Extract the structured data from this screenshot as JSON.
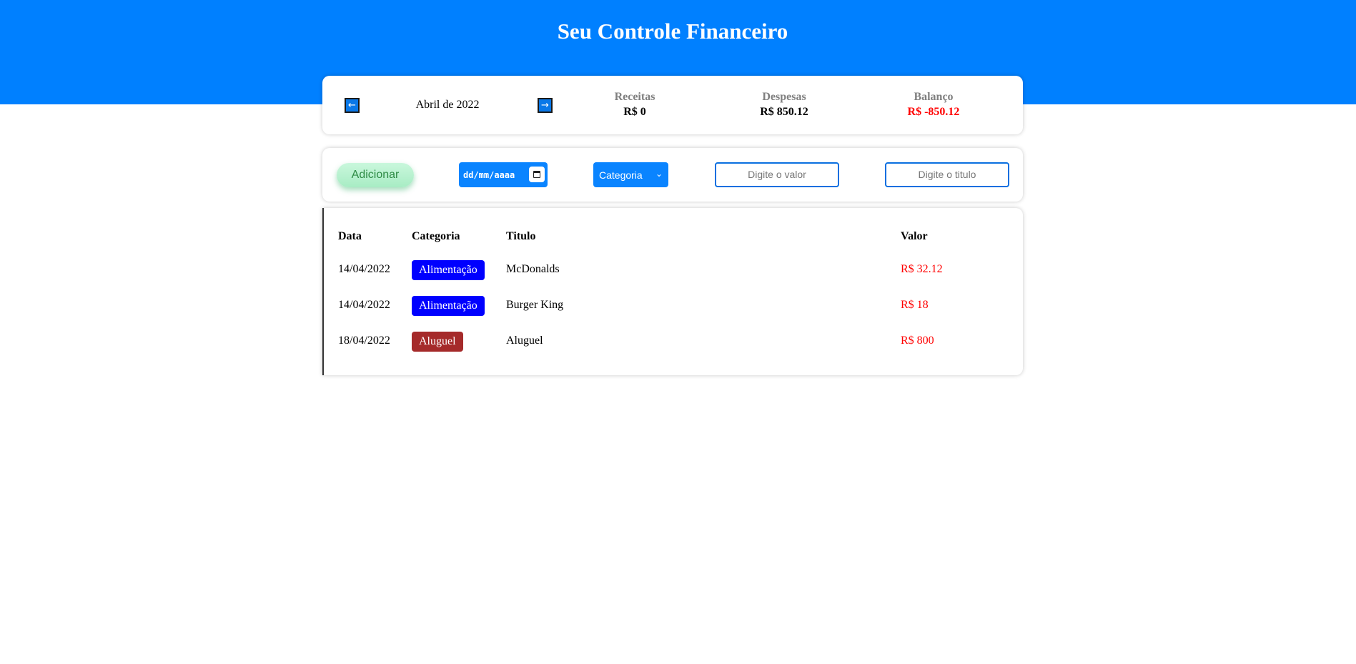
{
  "header": {
    "title": "Seu Controle Financeiro"
  },
  "summary": {
    "prev_icon": "arrow-left-icon",
    "next_icon": "arrow-right-icon",
    "month": "Abril de 2022",
    "income_label": "Receitas",
    "income_value": "R$ 0",
    "expense_label": "Despesas",
    "expense_value": "R$ 850.12",
    "balance_label": "Balanço",
    "balance_value": "R$ -850.12",
    "balance_color": "#ff0000"
  },
  "form": {
    "add_label": "Adicionar",
    "date_placeholder": "dd/mm/aaaa",
    "category_selected": "Categoria",
    "value_placeholder": "Digite o valor",
    "title_placeholder": "Digite o titulo"
  },
  "table": {
    "headers": {
      "date": "Data",
      "category": "Categoria",
      "title": "Titulo",
      "value": "Valor"
    },
    "rows": [
      {
        "date": "14/04/2022",
        "category": "Alimentação",
        "category_color": "#0000ff",
        "title": "McDonalds",
        "value": "R$ 32.12"
      },
      {
        "date": "14/04/2022",
        "category": "Alimentação",
        "category_color": "#0000ff",
        "title": "Burger King",
        "value": "R$ 18"
      },
      {
        "date": "18/04/2022",
        "category": "Aluguel",
        "category_color": "#a52a2a",
        "title": "Aluguel",
        "value": "R$ 800"
      }
    ]
  },
  "colors": {
    "header_bg": "#0080ff",
    "negative": "#ff0000",
    "input_blue": "#0a84ff"
  }
}
